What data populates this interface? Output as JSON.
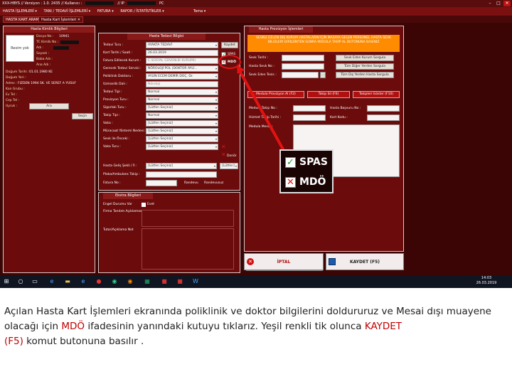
{
  "titlebar": {
    "text": "XXX-HBYS // Versiyon : 1.0.  2435 // Kullanıcı : ",
    "ip_label": "// IP",
    "pc_label": "PC",
    "minimize": "–",
    "maximize": "□",
    "close": "✕"
  },
  "menubar": {
    "items": [
      "HASTA İŞLEMLERİ ▾",
      "TANI / TEDAVİ İŞLEMLERİ ▾",
      "FATURA ▾",
      "RAPOR / İSTATİSTİKLER ▾",
      "Tema ▾"
    ]
  },
  "tabs": [
    "HASTA KART ARAMA",
    "Hasta Kart İşlemleri ✕"
  ],
  "patient_panel": {
    "title": "Hasta Kimlik Bilgileri",
    "photo_text": "Resim yok",
    "labels": [
      "Dosya No :",
      "TC Kimlik No :",
      "Adı :",
      "Soyadı :",
      "Baba Adı :",
      "Ana Adı :",
      "Doğum Tarihi :",
      "Doğum Yeri :",
      "Adres :",
      "Kan Grubu :",
      "Ev Tel :",
      "Cep Tel :",
      "Uyruk :"
    ],
    "values": [
      "10941",
      "",
      "",
      "",
      "",
      "",
      "01.01.1980 KE",
      "",
      "FIZDEN 1994 SK. VE SEREF A YUSUF",
      "",
      "",
      "",
      ""
    ],
    "search_button": "Ara",
    "select_button": "Seçin"
  },
  "treatment_panel": {
    "title": "Hasta Tedavi Bilgisi",
    "labels": [
      "Tedavi Turu :",
      "Kart Tarihi / Saati :",
      "Fatura Edilecek Kurum :",
      "Gerecek Tedavi Servisi :",
      "Poliklinik Doktoru :",
      "Uzmanlik Dalı :",
      "Tedavi Tipi :",
      "Provizyon Turu :",
      "Sigortalı Turu :",
      "Takip Tipi :",
      "Vaka :",
      "Müracaat Yöntemi Nedeni :",
      "Sevk ile Önceki :",
      "Vaka Turu :"
    ],
    "values": [
      "AYAKTA TEDAVİ",
      "26.03.2019",
      "C.SOSYAL GÜVENLİK KURUMU",
      "NÖROLOJİ POL (DOKTOR AYLİ...",
      "AYLİN ECEM DEMİR DOÇ. Dr.",
      "Nöroloji",
      "Normal",
      "Normal",
      "[Lütfen Seçiniz]",
      "Normal",
      "[Lütfen Seçiniz]",
      "[Lütfen Seçiniz]",
      "[Lütfen Seçiniz]",
      "[Lütfen Seçiniz]"
    ],
    "save_button": "Kaydet",
    "spas": "SPAS",
    "mdo": "MDÖ",
    "donor": "Donör",
    "bottom_labels": [
      "Hasta Geliş Şekli / İl :",
      "Plaka/Ambulans Takip :",
      "Fatura No :"
    ],
    "bottom_values": [
      "[Lütfen Seçiniz]",
      "",
      ""
    ],
    "bottom_extra": [
      "[Lütfen]",
      "Randevu",
      "Randevusuz"
    ]
  },
  "extra_panel": {
    "title": "Ekstra Bilgileri",
    "labels": [
      "Engel Durumu Var",
      "Firma Tanıtım Açıklaması",
      "Tutar/Açıklama Not"
    ],
    "checkbox_label": "Evet"
  },
  "referral_panel": {
    "title": "Hasta Provizyon İşlemleri",
    "orange_text": "SEVKLİ GELEN DIŞ KURUM HASTALARIN İÇİN MASAYA GELEN PERSONEL HASTA SEVK BİLGİLERİ GİRİLDİKTEN SONRA MEDULA TAKİP AL BUTONUNA BASINIZ",
    "labels": [
      "Sevk Tarihi :",
      "Hasta Sevk No :",
      "Sevk Eden Tesis :"
    ],
    "buttons": [
      "Sevk Eden Kurum Sorgula",
      "Tüm Diğer Yerden Sorgula",
      "Tüm Dış Yerden Hasta Sorgula"
    ],
    "red_buttons": [
      "Medula Provizyon Al (F2)",
      "Takip Sil (F6)",
      "Takipleri Göster (F10)"
    ],
    "row_labels": [
      "Medula Takip No :",
      "Hasta Başvuru No :",
      "Hizmet Takip Tarihi :",
      "Kart Kodu :",
      "Medula Mesaj :"
    ],
    "footer_buttons": [
      "İPTAL",
      "KAYDET (F5)"
    ]
  },
  "zoom": {
    "spas": "SPAS",
    "mdo": "MDÖ"
  },
  "taskbar": {
    "time": "14:03",
    "date": "26.03.2019"
  },
  "caption": {
    "part1": "Açılan Hasta Kart İşlemleri ekranında poliklinik ve doktor bilgilerini doldururuz ve Mesai dışı muayene olacağı için ",
    "mdo": "MDÖ",
    "part2": " ifadesinin yanındaki kutuyu tıklarız. Yeşil renkli tik olunca ",
    "kaydet": "KAYDET",
    "f5": "(F5)",
    "part3": " komut butonuna basılır ."
  },
  "colors": {
    "accent": "#e31212",
    "panel": "#6b0b0b",
    "orange": "#ff8c00",
    "check_green": "#1e9e1e"
  }
}
